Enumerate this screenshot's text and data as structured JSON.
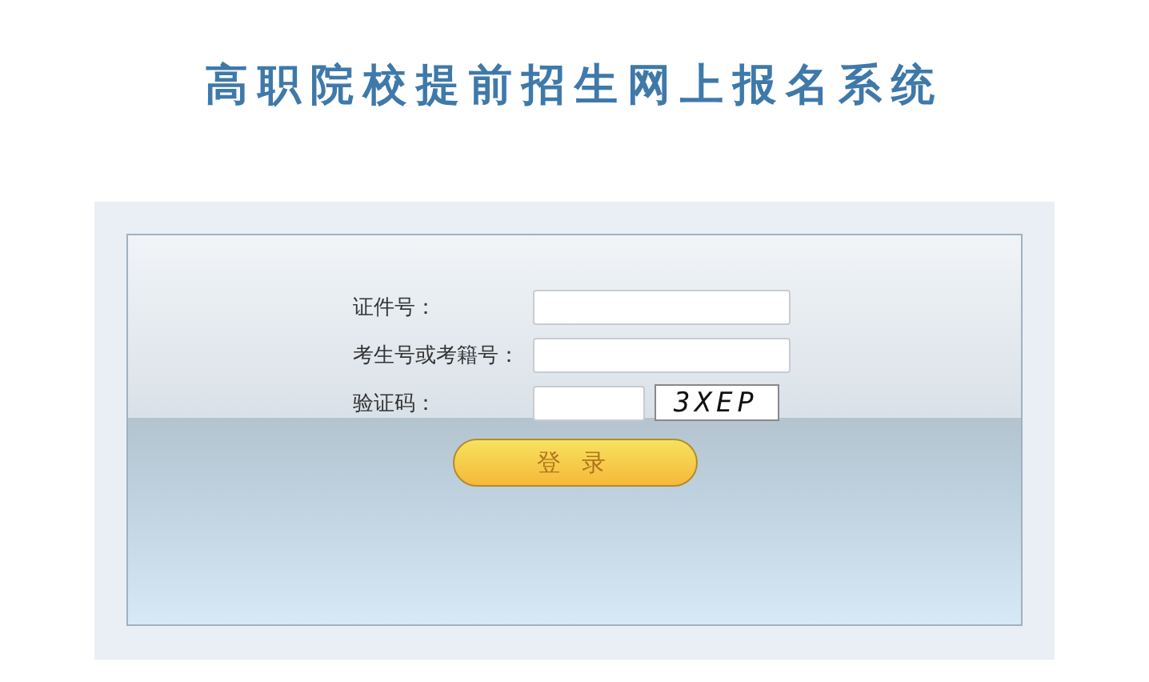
{
  "title": "高职院校提前招生网上报名系统",
  "fields": [
    {
      "label": "证件号：",
      "kind": "text"
    },
    {
      "label": "考生号或考籍号：",
      "kind": "text"
    },
    {
      "label": "验证码：",
      "kind": "captcha",
      "captcha": "3XEP"
    }
  ],
  "button": "登 录"
}
